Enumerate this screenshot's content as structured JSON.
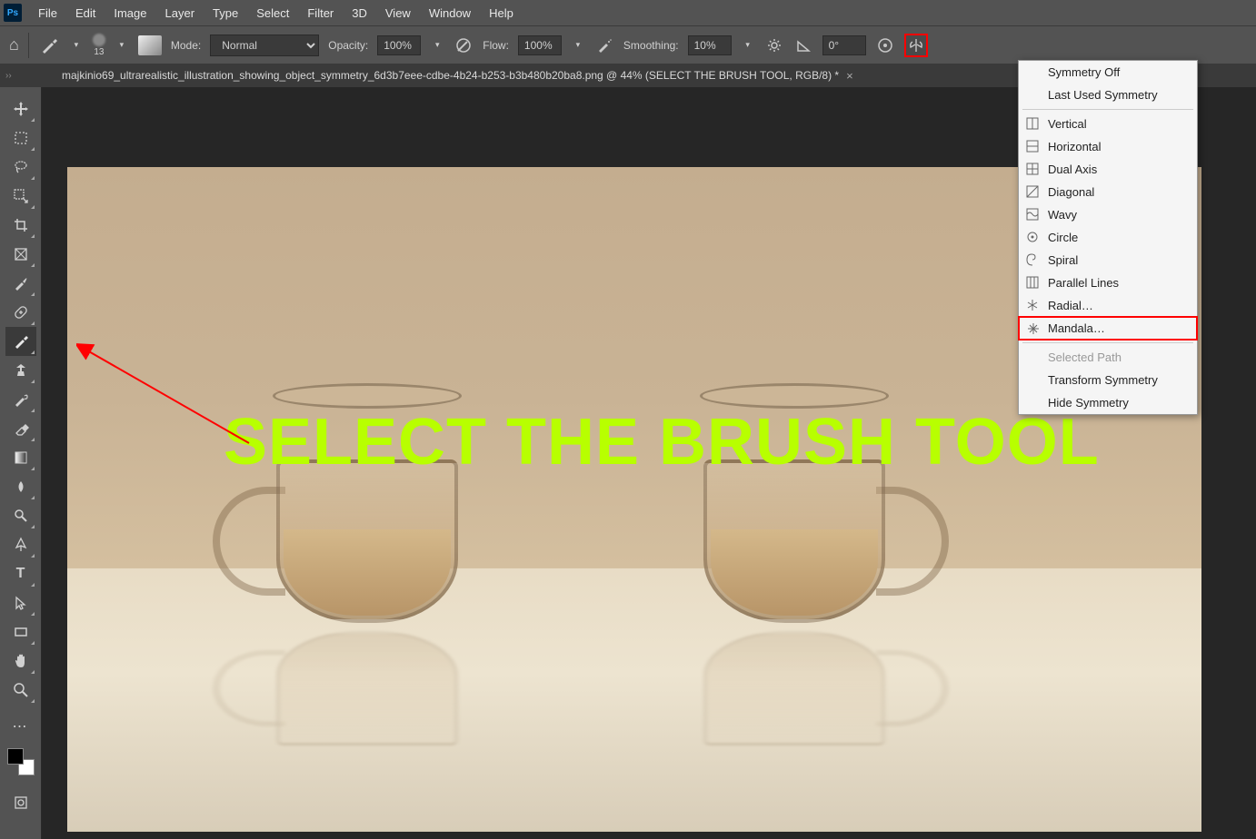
{
  "menu": {
    "items": [
      "File",
      "Edit",
      "Image",
      "Layer",
      "Type",
      "Select",
      "Filter",
      "3D",
      "View",
      "Window",
      "Help"
    ]
  },
  "options": {
    "brush_size": "13",
    "mode_label": "Mode:",
    "mode_value": "Normal",
    "opacity_label": "Opacity:",
    "opacity_value": "100%",
    "flow_label": "Flow:",
    "flow_value": "100%",
    "smoothing_label": "Smoothing:",
    "smoothing_value": "10%",
    "angle_value": "0°"
  },
  "document": {
    "tab_title": "majkinio69_ultrarealistic_illustration_showing_object_symmetry_6d3b7eee-cdbe-4b24-b253-b3b480b20ba8.png @ 44% (SELECT THE BRUSH TOOL, RGB/8) *",
    "close": "×"
  },
  "overlay": {
    "text": "SELECT THE BRUSH TOOL"
  },
  "symmetry_menu": {
    "off": "Symmetry Off",
    "last": "Last Used Symmetry",
    "vertical": "Vertical",
    "horizontal": "Horizontal",
    "dual_axis": "Dual Axis",
    "diagonal": "Diagonal",
    "wavy": "Wavy",
    "circle": "Circle",
    "spiral": "Spiral",
    "parallel": "Parallel Lines",
    "radial": "Radial…",
    "mandala": "Mandala…",
    "selected_path": "Selected Path",
    "transform": "Transform Symmetry",
    "hide": "Hide Symmetry"
  }
}
